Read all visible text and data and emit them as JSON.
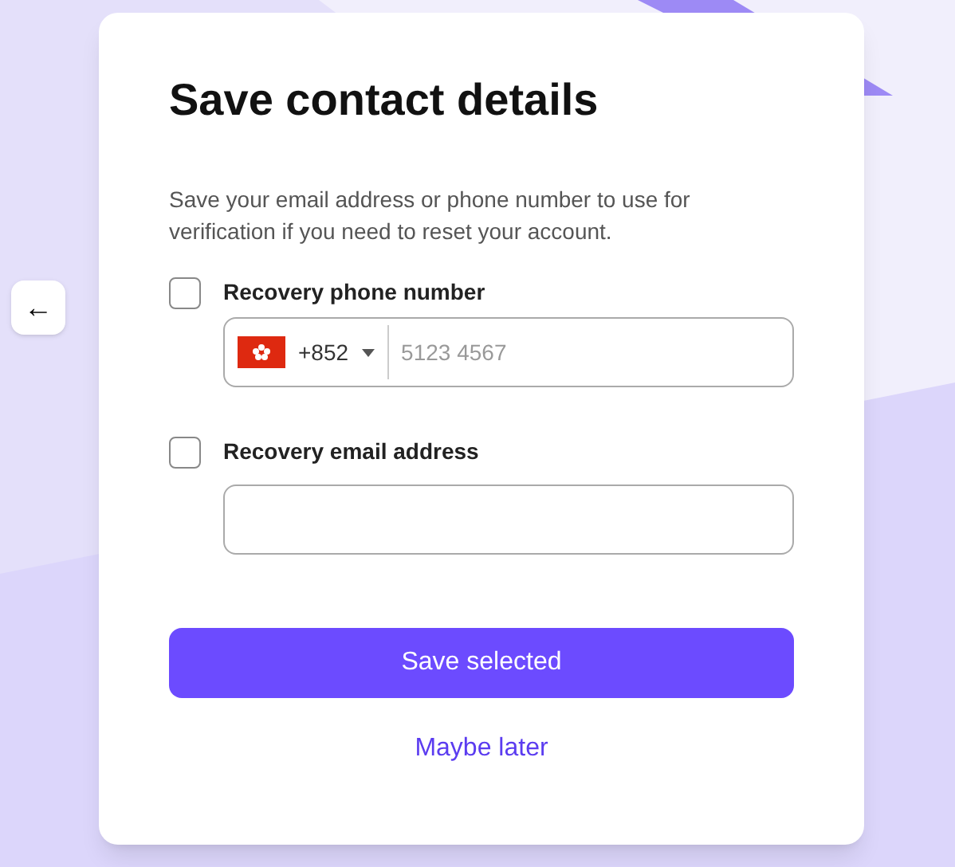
{
  "back_button": {
    "icon": "←"
  },
  "dialog": {
    "title": "Save contact details",
    "description": "Save your email address or phone number to use for verification if you need to reset your account.",
    "options": [
      {
        "kind": "phone",
        "label": "Recovery phone number",
        "checked": false,
        "country_code": "+852",
        "placeholder": "5123 4567"
      },
      {
        "kind": "email",
        "label": "Recovery email address",
        "checked": false
      }
    ],
    "primary_button": "Save selected",
    "secondary_link": "Maybe later"
  }
}
